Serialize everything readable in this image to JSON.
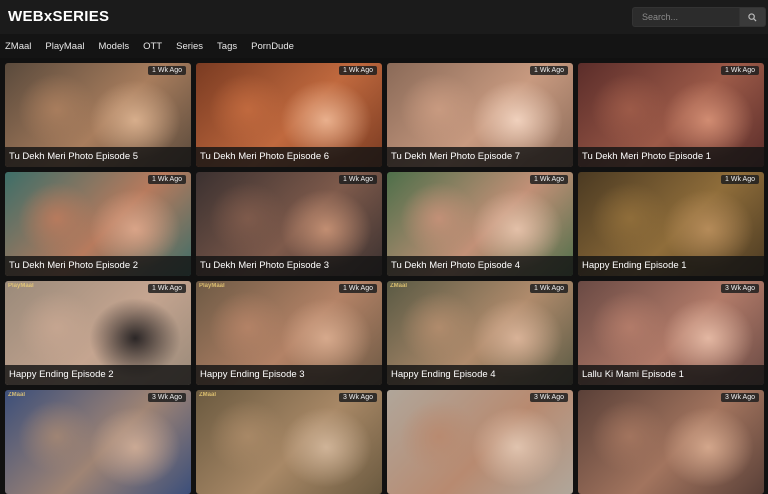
{
  "site": {
    "logo": "WEBxSERIES"
  },
  "search": {
    "placeholder": "Search..."
  },
  "nav": {
    "items": [
      "ZMaal",
      "PlayMaal",
      "Models",
      "OTT",
      "Series",
      "Tags",
      "PornDude"
    ]
  },
  "cards": [
    {
      "title": "Tu Dekh Meri Photo Episode 5",
      "age": "1 Wk Ago",
      "colors": [
        "#5a4a3c",
        "#a87d5d",
        "#d7ae8c"
      ],
      "watermark": ""
    },
    {
      "title": "Tu Dekh Meri Photo Episode 6",
      "age": "1 Wk Ago",
      "colors": [
        "#7a3b22",
        "#c0693e",
        "#e9b08d"
      ],
      "watermark": ""
    },
    {
      "title": "Tu Dekh Meri Photo Episode 7",
      "age": "1 Wk Ago",
      "colors": [
        "#8a6a58",
        "#c89a80",
        "#f0d1bd"
      ],
      "watermark": ""
    },
    {
      "title": "Tu Dekh Meri Photo Episode 1",
      "age": "1 Wk Ago",
      "colors": [
        "#5b2d2a",
        "#9c5a48",
        "#d18c72"
      ],
      "watermark": ""
    },
    {
      "title": "Tu Dekh Meri Photo Episode 2",
      "age": "1 Wk Ago",
      "colors": [
        "#3d6e68",
        "#b77a5d",
        "#d9a488"
      ],
      "watermark": ""
    },
    {
      "title": "Tu Dekh Meri Photo Episode 3",
      "age": "1 Wk Ago",
      "colors": [
        "#3b3130",
        "#7e5a4b",
        "#c28e72"
      ],
      "watermark": ""
    },
    {
      "title": "Tu Dekh Meri Photo Episode 4",
      "age": "1 Wk Ago",
      "colors": [
        "#4e6f4a",
        "#c29077",
        "#e3c0a8"
      ],
      "watermark": ""
    },
    {
      "title": "Happy Ending Episode 1",
      "age": "1 Wk Ago",
      "colors": [
        "#4b3a22",
        "#8f6d3a",
        "#b58b59"
      ],
      "watermark": ""
    },
    {
      "title": "Happy Ending Episode 2",
      "age": "1 Wk Ago",
      "colors": [
        "#9a8a7a",
        "#c5a590",
        "#2b2626"
      ],
      "watermark": "PlayMaal"
    },
    {
      "title": "Happy Ending Episode 3",
      "age": "1 Wk Ago",
      "colors": [
        "#6e5a45",
        "#b38266",
        "#d6a98c"
      ],
      "watermark": "PlayMaal"
    },
    {
      "title": "Happy Ending Episode 4",
      "age": "1 Wk Ago",
      "colors": [
        "#5a5a44",
        "#b08b6c",
        "#d8b297"
      ],
      "watermark": "ZMaal"
    },
    {
      "title": "Lallu Ki Mami Episode 1",
      "age": "3 Wk Ago",
      "colors": [
        "#6a4a44",
        "#b27b69",
        "#e3b7a2"
      ],
      "watermark": ""
    },
    {
      "title": "",
      "age": "3 Wk Ago",
      "colors": [
        "#3c4f7a",
        "#9f8474",
        "#caa994"
      ],
      "watermark": "ZMaal"
    },
    {
      "title": "",
      "age": "3 Wk Ago",
      "colors": [
        "#6b5a40",
        "#a88866",
        "#cfb397"
      ],
      "watermark": "ZMaal"
    },
    {
      "title": "",
      "age": "3 Wk Ago",
      "colors": [
        "#b0a69a",
        "#b88a70",
        "#e0c3ae"
      ],
      "watermark": ""
    },
    {
      "title": "",
      "age": "3 Wk Ago",
      "colors": [
        "#5a4038",
        "#a2745e",
        "#d3a68b"
      ],
      "watermark": ""
    }
  ]
}
